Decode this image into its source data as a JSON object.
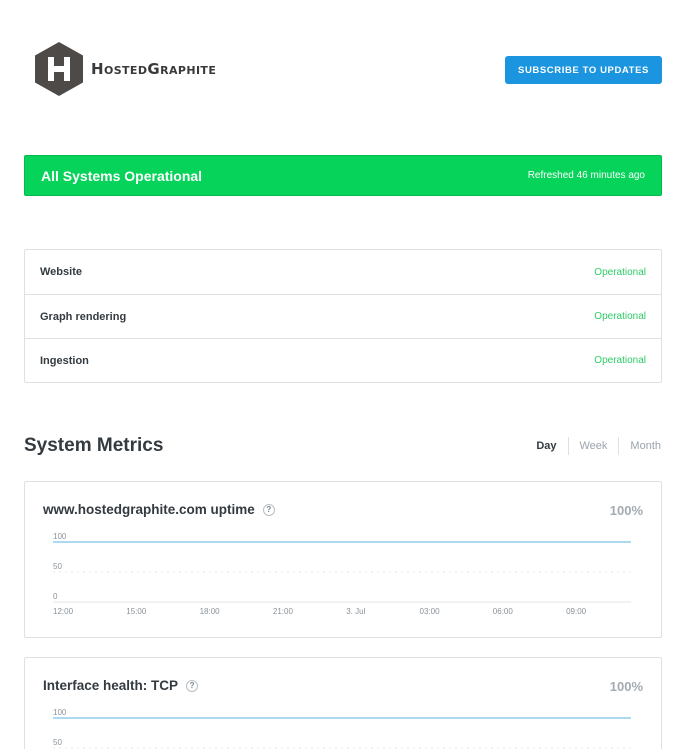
{
  "header": {
    "logo_text": "HostedGraphite",
    "subscribe_label": "SUBSCRIBE TO UPDATES"
  },
  "banner": {
    "title": "All Systems Operational",
    "refreshed": "Refreshed 46 minutes ago",
    "color": "#06d35a"
  },
  "components": [
    {
      "name": "Website",
      "status": "Operational"
    },
    {
      "name": "Graph rendering",
      "status": "Operational"
    },
    {
      "name": "Ingestion",
      "status": "Operational"
    }
  ],
  "metrics": {
    "title": "System Metrics",
    "tabs": [
      {
        "label": "Day",
        "active": true
      },
      {
        "label": "Week",
        "active": false
      },
      {
        "label": "Month",
        "active": false
      }
    ],
    "cards": [
      {
        "name": "www.hostedgraphite.com uptime",
        "value": "100%",
        "y_ticks": [
          "100",
          "50",
          "0"
        ],
        "x_ticks": [
          "12:00",
          "15:00",
          "18:00",
          "21:00",
          "3. Jul",
          "03:00",
          "06:00",
          "09:00"
        ]
      },
      {
        "name": "Interface health: TCP",
        "value": "100%",
        "y_ticks": [
          "100",
          "50"
        ]
      }
    ]
  },
  "chart_data": [
    {
      "type": "line",
      "title": "www.hostedgraphite.com uptime",
      "x": [
        "12:00",
        "15:00",
        "18:00",
        "21:00",
        "3. Jul",
        "03:00",
        "06:00",
        "09:00"
      ],
      "series": [
        {
          "values": [
            100,
            100,
            100,
            100,
            100,
            100,
            100,
            100
          ]
        }
      ],
      "ylim": [
        0,
        100
      ],
      "line_color": "#7cc4e8"
    },
    {
      "type": "line",
      "title": "Interface health: TCP",
      "series": [
        {
          "values": [
            100,
            100,
            100,
            100,
            100,
            100,
            100,
            100
          ]
        }
      ],
      "ylim": [
        0,
        100
      ],
      "line_color": "#7cc4e8"
    }
  ],
  "icons": {
    "logo": "hexagon-h-logo-icon",
    "help": "question-mark-icon"
  }
}
